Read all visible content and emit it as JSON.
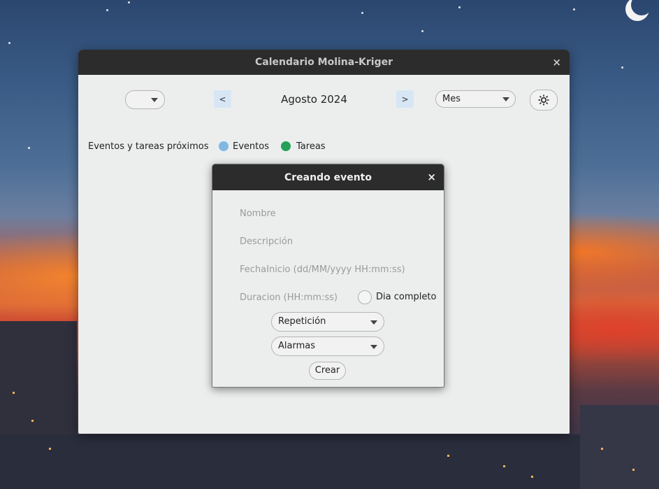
{
  "window": {
    "title": "Calendario Molina-Kriger",
    "close_glyph": "×"
  },
  "toolbar": {
    "prev_label": "<",
    "next_label": ">",
    "month_label": "Agosto 2024",
    "view_select": "Mes",
    "theme_icon": "sun-icon"
  },
  "legend": {
    "heading": "Eventos y tareas próximos",
    "items": [
      {
        "label": "Eventos",
        "color": "#7eb8e3"
      },
      {
        "label": "Tareas",
        "color": "#25a05a"
      }
    ]
  },
  "dialog": {
    "title": "Creando evento",
    "close_glyph": "×",
    "fields": {
      "name_placeholder": "Nombre",
      "description_placeholder": "Descripción",
      "start_placeholder": "FechaInicio (dd/MM/yyyy HH:mm:ss)",
      "duration_placeholder": "Duracion (HH:mm:ss)"
    },
    "all_day_label": "Dia completo",
    "repeat_select": "Repetición",
    "alarms_select": "Alarmas",
    "create_label": "Crear"
  }
}
